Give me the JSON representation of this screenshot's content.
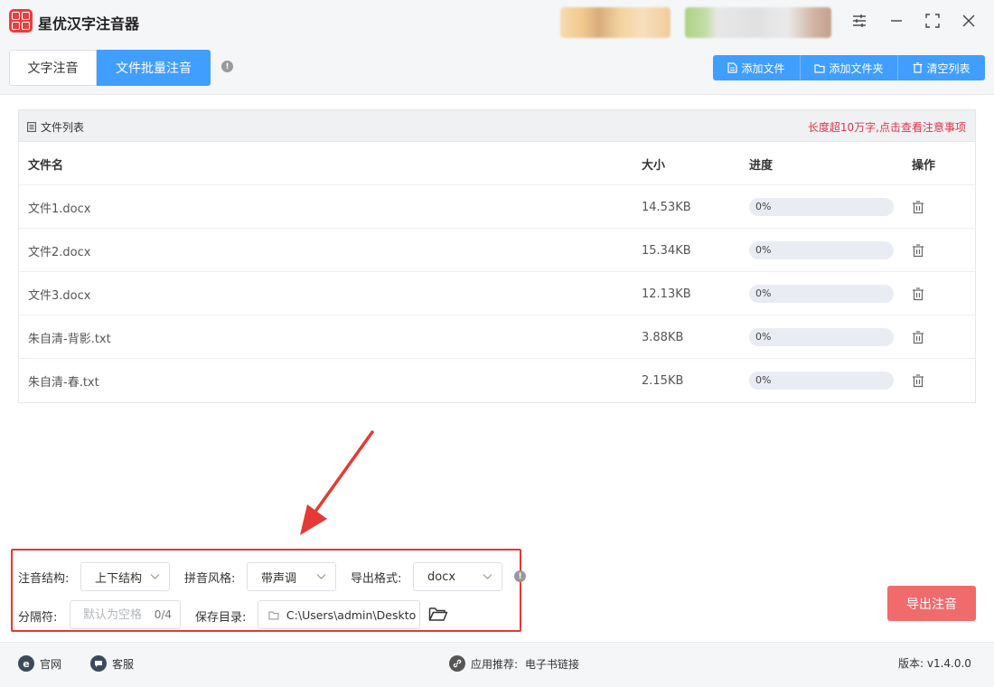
{
  "app": {
    "title": "星优汉字注音器"
  },
  "tabs": [
    {
      "label": "文字注音",
      "active": false
    },
    {
      "label": "文件批量注音",
      "active": true
    }
  ],
  "toolbar": {
    "add_file": "添加文件",
    "add_folder": "添加文件夹",
    "clear_list": "清空列表"
  },
  "file_list": {
    "title": "文件列表",
    "notice": "长度超10万字,点击查看注意事项",
    "columns": {
      "name": "文件名",
      "size": "大小",
      "progress": "进度",
      "action": "操作"
    },
    "rows": [
      {
        "name": "文件1.docx",
        "size": "14.53KB",
        "progress": "0%",
        "progress_value": 0
      },
      {
        "name": "文件2.docx",
        "size": "15.34KB",
        "progress": "0%",
        "progress_value": 0
      },
      {
        "name": "文件3.docx",
        "size": "12.13KB",
        "progress": "0%",
        "progress_value": 0
      },
      {
        "name": "朱自清-背影.txt",
        "size": "3.88KB",
        "progress": "0%",
        "progress_value": 0
      },
      {
        "name": "朱自清-春.txt",
        "size": "2.15KB",
        "progress": "0%",
        "progress_value": 0
      }
    ]
  },
  "options": {
    "structure_label": "注音结构:",
    "structure_value": "上下结构",
    "style_label": "拼音风格:",
    "style_value": "带声调",
    "format_label": "导出格式:",
    "format_value": "docx",
    "separator_label": "分隔符:",
    "separator_placeholder": "默认为空格",
    "separator_counter": "0/4",
    "save_dir_label": "保存目录:",
    "save_dir_value": "C:\\Users\\admin\\Deskto"
  },
  "export_button": "导出注音",
  "footer": {
    "website": "官网",
    "support": "客服",
    "recommend_label": "应用推荐:",
    "recommend_link": "电子书链接",
    "version": "版本: v1.4.0.0"
  },
  "colors": {
    "primary": "#409eff",
    "danger": "#e53935",
    "export": "#f06b6b",
    "notice": "#e0334b"
  },
  "icons": {
    "logo": "app-logo",
    "settings": "sliders-icon",
    "minimize": "minimize-icon",
    "maximize": "maximize-icon",
    "close": "close-icon",
    "delete": "trash-icon",
    "folder": "folder-icon"
  }
}
